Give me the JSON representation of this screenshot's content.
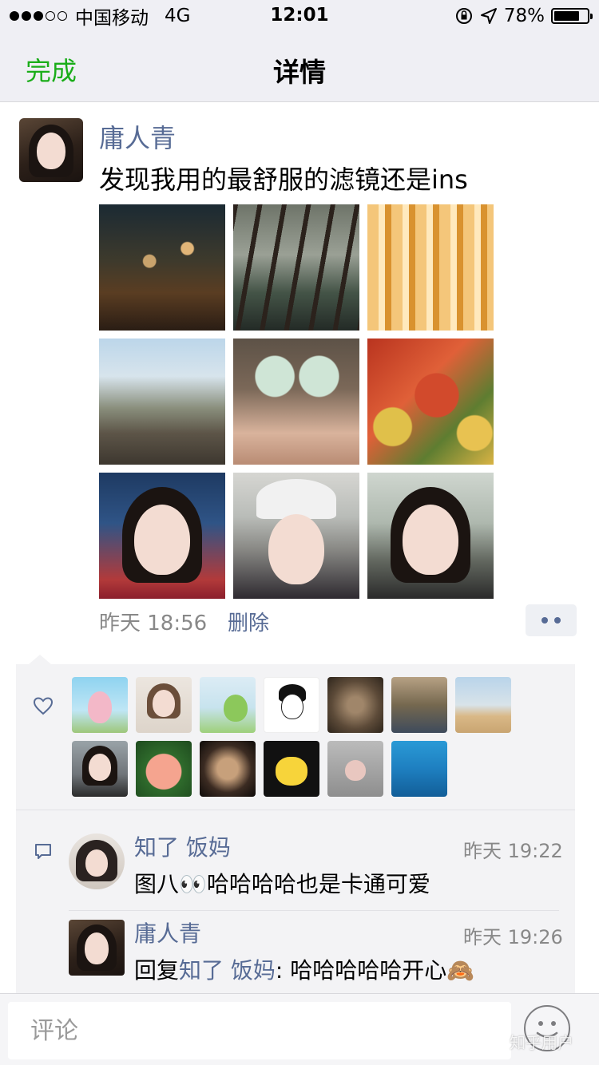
{
  "status_bar": {
    "carrier": "中国移动",
    "network": "4G",
    "time": "12:01",
    "battery": "78%",
    "battery_level": 0.78
  },
  "nav": {
    "done": "完成",
    "title": "详情"
  },
  "post": {
    "author": "庸人青",
    "text": "发现我用的最舒服的滤镜还是ins",
    "time": "昨天 18:56",
    "delete": "删除"
  },
  "comments": [
    {
      "author": "知了 饭妈",
      "time": "昨天 19:22",
      "text": "图八👀哈哈哈哈也是卡通可爱"
    },
    {
      "author": "庸人青",
      "time": "昨天 19:26",
      "reply_prefix": "回复",
      "reply_to": "知了 饭妈",
      "text": ": 哈哈哈哈哈开心🙈"
    }
  ],
  "input": {
    "placeholder": "评论"
  },
  "watermark": "知乎用户",
  "colors": {
    "accent_green": "#1aad19",
    "link_blue": "#576b95"
  }
}
